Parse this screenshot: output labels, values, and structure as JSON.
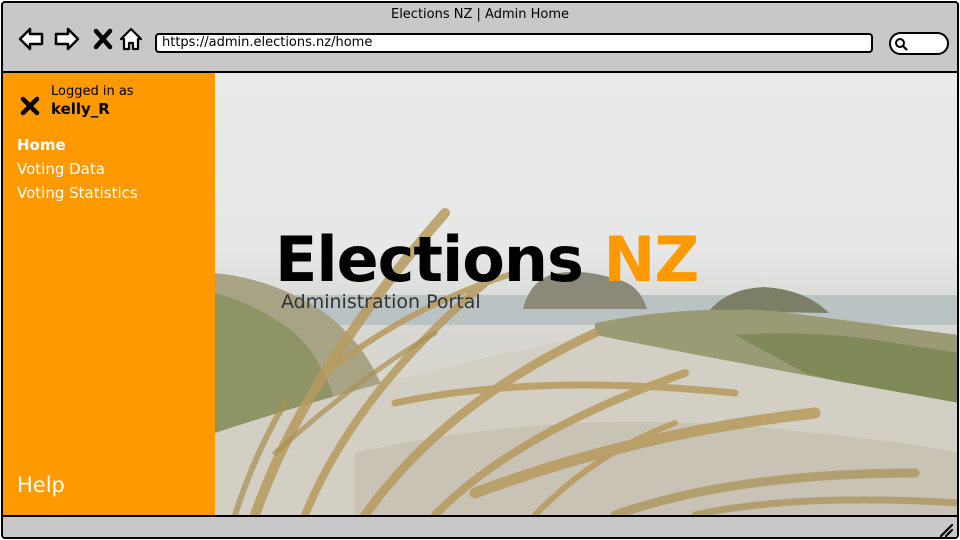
{
  "window": {
    "title": "Elections NZ | Admin Home"
  },
  "browser": {
    "url": "https://admin.elections.nz/home",
    "icons": [
      "back-icon",
      "forward-icon",
      "close-icon",
      "home-icon",
      "search-icon"
    ]
  },
  "sidebar": {
    "logged_in_label": "Logged in as",
    "username": "kelly_R",
    "items": [
      {
        "label": "Home",
        "active": true
      },
      {
        "label": "Voting Data",
        "active": false
      },
      {
        "label": "Voting Statistics",
        "active": false
      }
    ],
    "help_label": "Help"
  },
  "hero": {
    "brand_main": "Elections ",
    "brand_accent": "NZ",
    "subtitle": "Administration Portal"
  },
  "colors": {
    "accent": "#ff9900",
    "chrome": "#c8c8c8"
  }
}
